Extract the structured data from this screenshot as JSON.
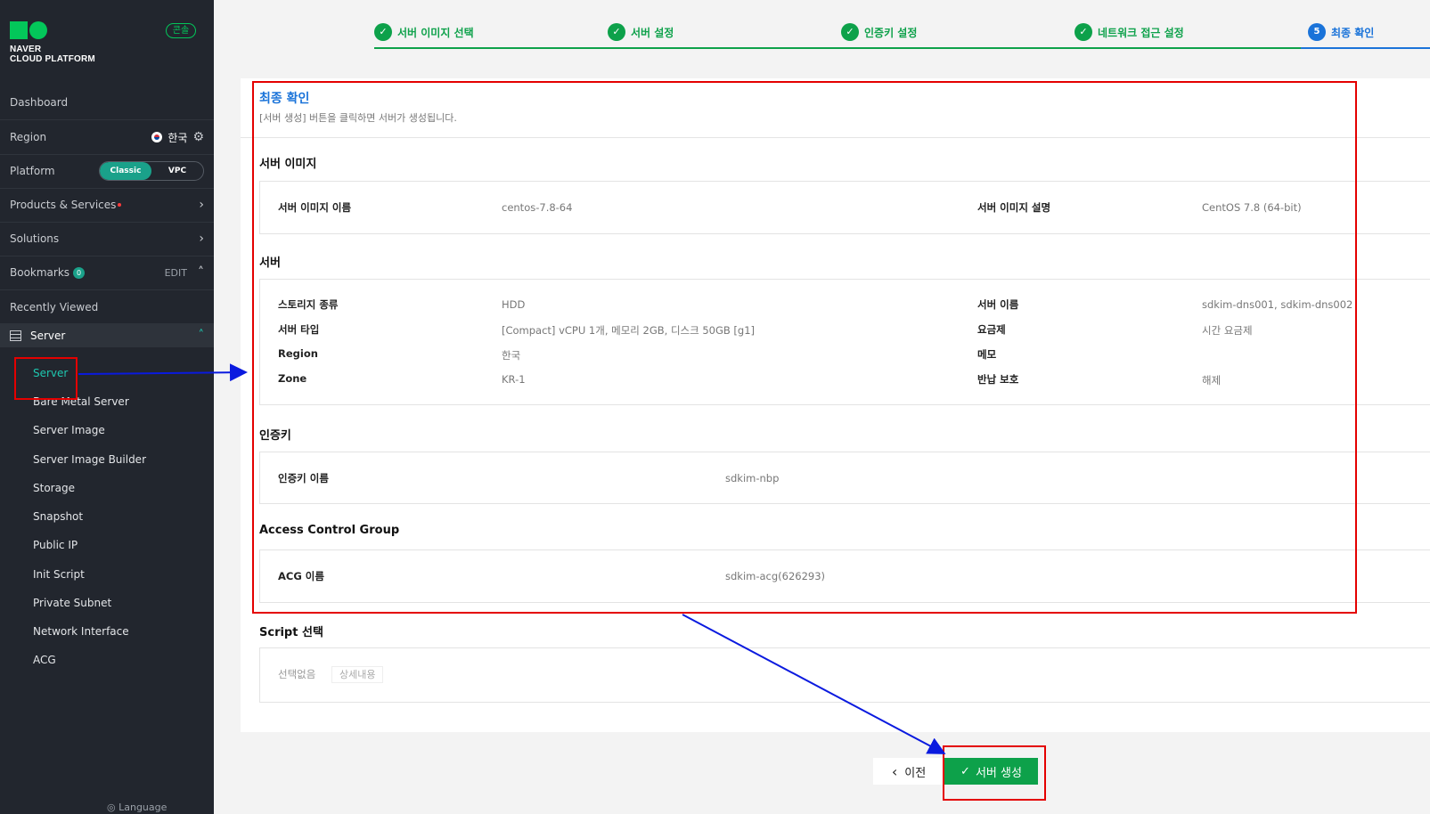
{
  "sidebar": {
    "logo_line1": "NAVER",
    "logo_line2": "CLOUD PLATFORM",
    "console_badge": "콘솔",
    "dashboard": "Dashboard",
    "region_label": "Region",
    "region_value": "한국",
    "platform_label": "Platform",
    "platform_options": [
      "Classic",
      "VPC"
    ],
    "platform_selected": "Classic",
    "products": "Products & Services",
    "solutions": "Solutions",
    "bookmarks": "Bookmarks",
    "bookmarks_count": "0",
    "bookmarks_edit": "EDIT",
    "recently_viewed": "Recently Viewed",
    "server_group": "Server",
    "sub_items": [
      "Server",
      "Bare Metal Server",
      "Server Image",
      "Server Image Builder",
      "Storage",
      "Snapshot",
      "Public IP",
      "Init Script",
      "Private Subnet",
      "Network Interface",
      "ACG"
    ],
    "language": "Language"
  },
  "steps": [
    {
      "label": "서버 이미지 선택",
      "state": "done"
    },
    {
      "label": "서버 설정",
      "state": "done"
    },
    {
      "label": "인증키 설정",
      "state": "done"
    },
    {
      "label": "네트워크 접근 설정",
      "state": "done"
    },
    {
      "label": "최종 확인",
      "state": "current",
      "number": "5"
    }
  ],
  "main": {
    "title": "최종 확인",
    "description": "[서버 생성] 버튼을 클릭하면 서버가 생성됩니다.",
    "server_image": {
      "title": "서버 이미지",
      "name_label": "서버 이미지 이름",
      "name_value": "centos-7.8-64",
      "desc_label": "서버 이미지 설명",
      "desc_value": "CentOS 7.8 (64-bit)"
    },
    "server": {
      "title": "서버",
      "storage_label": "스토리지 종류",
      "storage_value": "HDD",
      "type_label": "서버 타입",
      "type_value": "[Compact] vCPU 1개, 메모리 2GB, 디스크 50GB [g1]",
      "region_label": "Region",
      "region_value": "한국",
      "zone_label": "Zone",
      "zone_value": "KR-1",
      "name_label": "서버 이름",
      "name_value": "sdkim-dns001, sdkim-dns002",
      "fee_label": "요금제",
      "fee_value": "시간 요금제",
      "memo_label": "메모",
      "memo_value": "",
      "protect_label": "반납 보호",
      "protect_value": "해제"
    },
    "auth_key": {
      "title": "인증키",
      "name_label": "인증키 이름",
      "name_value": "sdkim-nbp"
    },
    "acg": {
      "title": "Access Control Group",
      "name_label": "ACG 이름",
      "name_value": "sdkim-acg(626293)"
    },
    "script": {
      "title": "Script 선택",
      "value": "선택없음",
      "detail_button": "상세내용"
    }
  },
  "buttons": {
    "prev": "이전",
    "create": "서버 생성"
  },
  "colors": {
    "sidebar_bg": "#22262e",
    "accent_green": "#0da14a",
    "accent_teal": "#1ec8b0",
    "accent_blue": "#1a73d9",
    "annotation_red": "#e40000",
    "annotation_arrow": "#0a1adf"
  }
}
